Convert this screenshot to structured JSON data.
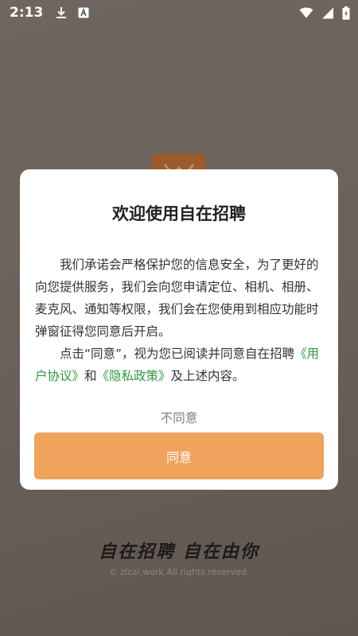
{
  "status_bar": {
    "time": "2:13",
    "icons": [
      "download-icon",
      "a-badge-icon",
      "wifi-icon",
      "signal-icon",
      "battery-charging-icon"
    ]
  },
  "dialog": {
    "title": "欢迎使用自在招聘",
    "para1": "我们承诺会严格保护您的信息安全，为了更好的向您提供服务，我们会向您申请定位、相机、相册、麦克风、通知等权限，我们会在您使用到相应功能时弹窗征得您同意后开启。",
    "para2_prefix": "点击“同意”，视为您已阅读并同意自在招聘",
    "user_agreement_link": "《用户协议》",
    "and_text": "和",
    "privacy_policy_link": "《隐私政策》",
    "para2_suffix": "及上述内容。",
    "disagree_label": "不同意",
    "agree_label": "同意"
  },
  "footer": {
    "slogan": "自在招聘 自在由你",
    "copyright": "© zizai.work All rights reserved."
  },
  "colors": {
    "accent": "#f0a35c",
    "link": "#2b9a3f",
    "background": "#6a625b"
  }
}
